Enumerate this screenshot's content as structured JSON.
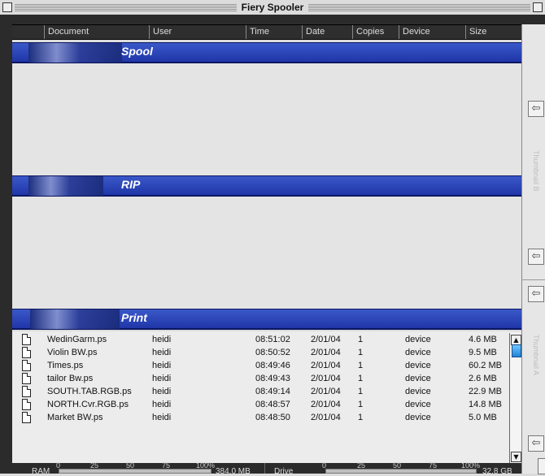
{
  "window": {
    "title": "Fiery Spooler"
  },
  "columns": [
    "Document",
    "User",
    "Time",
    "Date",
    "Copies",
    "Device",
    "Size"
  ],
  "sections": {
    "spool": "Spool",
    "rip": "RIP",
    "print": "Print"
  },
  "print_jobs": [
    {
      "document": "WedinGarm.ps",
      "user": "heidi",
      "time": "08:51:02",
      "date": "2/01/04",
      "copies": "1",
      "device": "device",
      "size": "4.6 MB"
    },
    {
      "document": "Violin BW.ps",
      "user": "heidi",
      "time": "08:50:52",
      "date": "2/01/04",
      "copies": "1",
      "device": "device",
      "size": "9.5 MB"
    },
    {
      "document": "Times.ps",
      "user": "heidi",
      "time": "08:49:46",
      "date": "2/01/04",
      "copies": "1",
      "device": "device",
      "size": "60.2 MB"
    },
    {
      "document": "tailor Bw.ps",
      "user": "heidi",
      "time": "08:49:43",
      "date": "2/01/04",
      "copies": "1",
      "device": "device",
      "size": "2.6 MB"
    },
    {
      "document": "SOUTH.TAB.RGB.ps",
      "user": "heidi",
      "time": "08:49:14",
      "date": "2/01/04",
      "copies": "1",
      "device": "device",
      "size": "22.9 MB"
    },
    {
      "document": "NORTH.Cvr.RGB.ps",
      "user": "heidi",
      "time": "08:48:57",
      "date": "2/01/04",
      "copies": "1",
      "device": "device",
      "size": "14.8 MB"
    },
    {
      "document": "Market BW.ps",
      "user": "heidi",
      "time": "08:48:50",
      "date": "2/01/04",
      "copies": "1",
      "device": "device",
      "size": "5.0 MB"
    }
  ],
  "drawer": {
    "thumbnail_b": "Thumbnail B",
    "thumbnail_a": "Thumbnail A"
  },
  "status": {
    "scale_ticks": [
      "0",
      "25",
      "50",
      "75",
      "100%"
    ],
    "ram_label": "RAM",
    "ram_value": "384.0 MB",
    "ram_level": 0.0,
    "drive_label": "Drive",
    "drive_value": "32.8 GB",
    "drive_level": 0.0
  },
  "icons": {
    "drawer_arrow": "left-arrow-icon",
    "doc": "document-icon"
  },
  "colors": {
    "band": "#2b43b8",
    "scroll_thumb": "#2a8ae0"
  }
}
